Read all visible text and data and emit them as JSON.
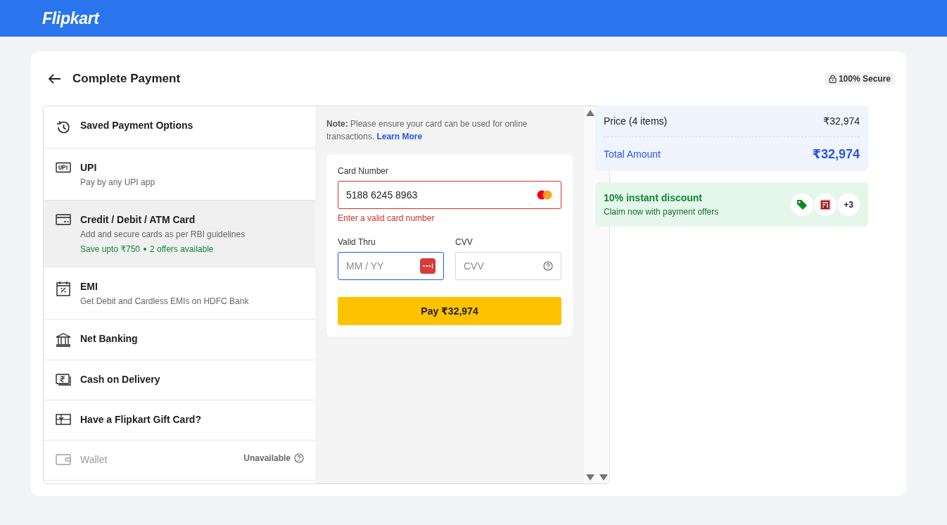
{
  "header": {
    "logo": "Flipkart"
  },
  "page": {
    "title": "Complete Payment",
    "secure_label": "100% Secure"
  },
  "methods": [
    {
      "kind": "saved",
      "title": "Saved Payment Options",
      "selected": false,
      "disabled": false
    },
    {
      "kind": "upi",
      "title": "UPI",
      "subtitle": "Pay by any UPI app",
      "selected": false,
      "disabled": false
    },
    {
      "kind": "card",
      "title": "Credit / Debit / ATM Card",
      "subtitle": "Add and secure cards as per RBI guidelines",
      "offer": "Save upto ₹750",
      "offer_count": "2 offers available",
      "selected": true,
      "disabled": false
    },
    {
      "kind": "emi",
      "title": "EMI",
      "subtitle": "Get Debit and Cardless EMIs on HDFC Bank",
      "selected": false,
      "disabled": false
    },
    {
      "kind": "netbanking",
      "title": "Net Banking",
      "selected": false,
      "disabled": false
    },
    {
      "kind": "cod",
      "title": "Cash on Delivery",
      "selected": false,
      "disabled": false
    },
    {
      "kind": "giftcard",
      "title": "Have a Flipkart Gift Card?",
      "selected": false,
      "disabled": false
    },
    {
      "kind": "wallet",
      "title": "Wallet",
      "status": "Unavailable",
      "selected": false,
      "disabled": true
    }
  ],
  "card_form": {
    "note_label": "Note:",
    "note": "Please ensure your card can be used for online transactions.",
    "learn_more": "Learn More",
    "card_number": {
      "label": "Card Number",
      "value": "5188 6245 8963",
      "error": "Enter a valid card number"
    },
    "valid_thru": {
      "label": "Valid Thru",
      "placeholder": "MM / YY",
      "focused": true
    },
    "cvv": {
      "label": "CVV",
      "placeholder": "CVV",
      "focused": false
    },
    "pay_button": "Pay ₹32,974"
  },
  "summary": {
    "price_label": "Price (4 items)",
    "price": "₹32,974",
    "total_label": "Total Amount",
    "total": "₹32,974"
  },
  "offer": {
    "title": "10% instant discount",
    "subtitle": "Claim now with payment offers",
    "more": "+3"
  }
}
